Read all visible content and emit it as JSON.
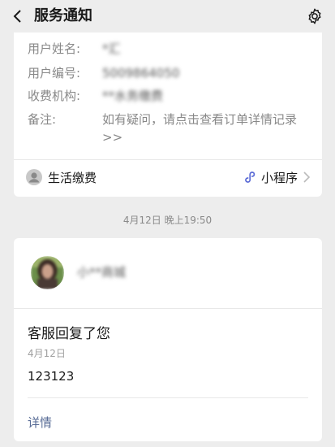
{
  "header": {
    "title": "服务通知"
  },
  "bill_card": {
    "rows": [
      {
        "label": "用户姓名:",
        "value": "*汇"
      },
      {
        "label": "用户编号:",
        "value": "5009864050"
      },
      {
        "label": "收费机构:",
        "value": "**水务缴费"
      },
      {
        "label": "备注:",
        "value": "如有疑问，请点击查看订单详情记录>>"
      }
    ],
    "footer_left": "生活缴费",
    "footer_right": "小程序"
  },
  "timestamp": "4月12日 晚上19:50",
  "message_card": {
    "sender_name": "小**商城",
    "title": "客服回复了您",
    "date": "4月12日",
    "body": "123123",
    "detail_link": "详情"
  },
  "colors": {
    "background": "#ededed",
    "card": "#ffffff",
    "link": "#576b95",
    "miniprogram_icon": "#5b6bd6"
  }
}
